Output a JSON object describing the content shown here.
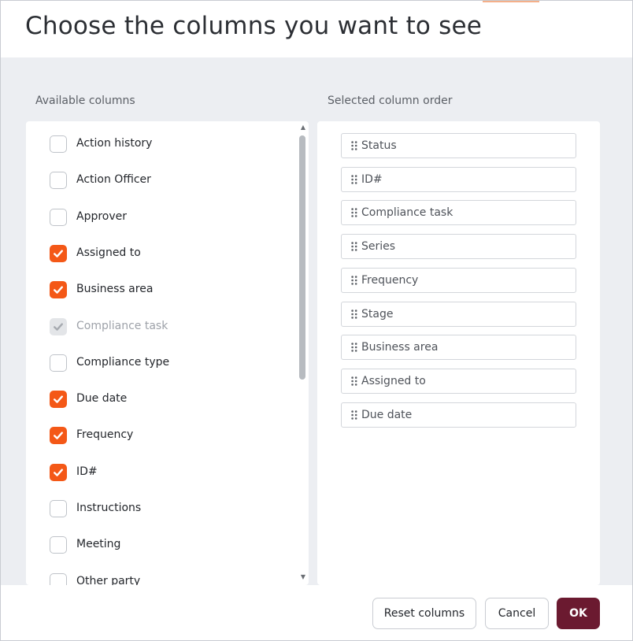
{
  "dialog": {
    "title": "Choose the columns you want to see",
    "available_label": "Available columns",
    "selected_label": "Selected column order"
  },
  "available_columns": [
    {
      "label": "Action history",
      "state": "unchecked"
    },
    {
      "label": "Action Officer",
      "state": "unchecked"
    },
    {
      "label": "Approver",
      "state": "unchecked"
    },
    {
      "label": "Assigned to",
      "state": "checked"
    },
    {
      "label": "Business area",
      "state": "checked"
    },
    {
      "label": "Compliance task",
      "state": "disabled-checked"
    },
    {
      "label": "Compliance type",
      "state": "unchecked"
    },
    {
      "label": "Due date",
      "state": "checked"
    },
    {
      "label": "Frequency",
      "state": "checked"
    },
    {
      "label": "ID#",
      "state": "checked"
    },
    {
      "label": "Instructions",
      "state": "unchecked"
    },
    {
      "label": "Meeting",
      "state": "unchecked"
    },
    {
      "label": "Other party",
      "state": "unchecked"
    }
  ],
  "selected_columns": [
    "Status",
    "ID#",
    "Compliance task",
    "Series",
    "Frequency",
    "Stage",
    "Business area",
    "Assigned to",
    "Due date"
  ],
  "footer": {
    "reset_label": "Reset columns",
    "cancel_label": "Cancel",
    "ok_label": "OK"
  },
  "colors": {
    "accent": "#f45817",
    "primary_button": "#6b1a30",
    "disabled_check": "#e3e5e8"
  },
  "icons": {
    "checkmark": "check-icon",
    "drag_handle": "drag-handle-icon",
    "scroll_up": "scroll-up-arrow-icon",
    "scroll_down": "scroll-down-arrow-icon"
  }
}
